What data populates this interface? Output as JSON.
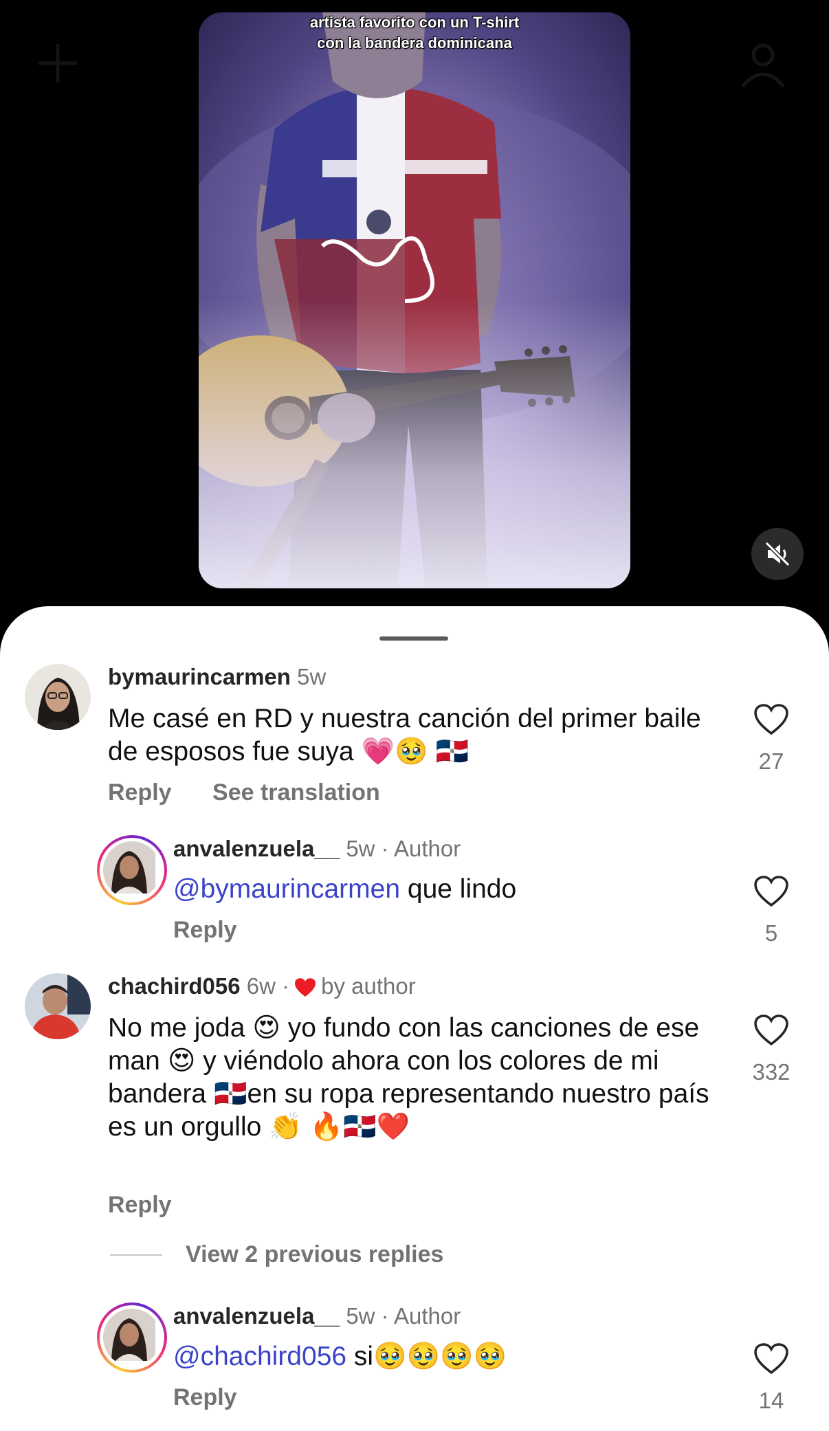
{
  "video": {
    "caption_line1": "artista favorito con un T-shirt",
    "caption_line2": "con la bandera dominicana",
    "mute_icon": "speaker-muted-icon"
  },
  "comments": [
    {
      "username": "bymaurincarmen",
      "time": "5w",
      "text": "Me casé en RD y nuestra canción del primer baile de esposos fue suya 💗🥹 🇩🇴",
      "reply_label": "Reply",
      "translate_label": "See translation",
      "likes": "27"
    },
    {
      "username": "anvalenzuela__",
      "time": "5w · Author",
      "mention": "@bymaurincarmen",
      "text": " que lindo",
      "reply_label": "Reply",
      "likes": "5"
    },
    {
      "username": "chachird056",
      "time": "6w ·",
      "liked_by": "by author",
      "text": "No me joda 😍 yo fundo con las canciones de ese man 😍 y viéndolo ahora con los colores de mi bandera 🇩🇴en su ropa representando nuestro país es un orgullo 👏 🔥🇩🇴❤️",
      "reply_label": "Reply",
      "likes": "332"
    },
    {
      "username": "anvalenzuela__",
      "time": "5w · Author",
      "mention": "@chachird056",
      "text": " si🥹🥹🥹🥹",
      "reply_label": "Reply",
      "likes": "14"
    }
  ],
  "view_previous_label": "View 2 previous replies",
  "colors": {
    "mention": "#3b43c9",
    "muted_text": "#737373",
    "heart_red": "#ed1c24"
  }
}
